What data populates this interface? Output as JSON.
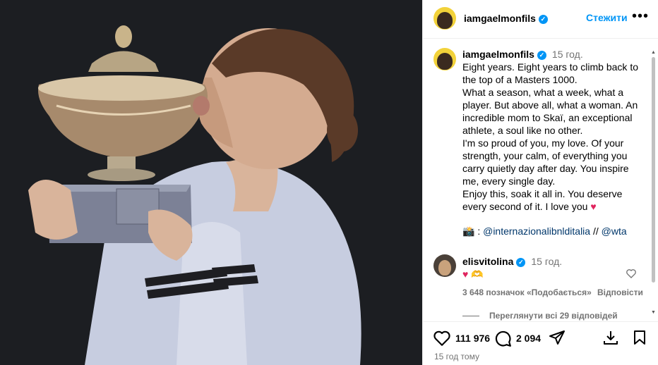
{
  "post": {
    "username": "iamgaelmonfils",
    "follow_label": "Стежити",
    "more_label": "•••",
    "caption_time": "15 год.",
    "caption_text": "Eight years. Eight years to climb back to the top of a Masters 1000.\nWhat a season, what a week, what a player. But above all, what a woman. An incredible mom to Skaï, an exceptional athlete, a soul like no other.\nI'm so proud of you, my love. Of your strength, your calm, of everything you carry quietly day after day. You inspire me, every single day.\nEnjoy this, soak it all in. You deserve every second of it. I love you",
    "caption_heart": "♥",
    "camera_glyph": "📸",
    "mention_prefix": ":",
    "mention_1": "@internazionalibnlditalia",
    "mention_sep": "//",
    "mention_2": "@wta",
    "verified_glyph": "✓"
  },
  "reply": {
    "username": "elisvitolina",
    "time": "15 год.",
    "heart": "♥",
    "emoji": "🫶",
    "likes": "3 648 позначок «Подобається»",
    "reply_label": "Відповісти",
    "view_replies": "Переглянути всі 29 відповідей"
  },
  "actions": {
    "likes": "111 976",
    "comments": "2 094",
    "posted": "15 год тому"
  },
  "colors": {
    "accent": "#0095f6",
    "heart": "#e0245e",
    "mention": "#00376b",
    "muted": "#737373"
  },
  "icons": [
    "heart-icon",
    "comment-icon",
    "share-icon",
    "download-icon",
    "bookmark-icon",
    "verified-icon",
    "more-icon"
  ]
}
